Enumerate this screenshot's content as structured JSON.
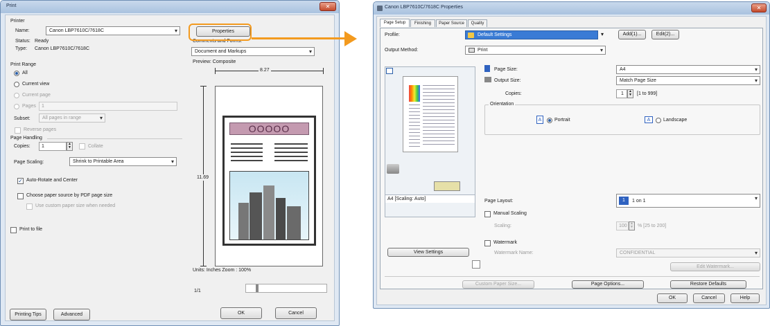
{
  "print_dialog": {
    "title": "Print",
    "printer_section": "Printer",
    "name_label": "Name:",
    "name_value": "Canon LBP7610C/7618C",
    "properties_button": "Properties",
    "status_label": "Status:",
    "status_value": "Ready",
    "type_label": "Type:",
    "type_value": "Canon LBP7610C/7618C",
    "comments_label": "Comments and Forms:",
    "comments_value": "Document and Markups",
    "print_range_label": "Print Range",
    "range_all": "All",
    "range_current_view": "Current view",
    "range_current_page": "Current page",
    "range_pages": "Pages",
    "pages_value": "1",
    "subset_label": "Subset:",
    "subset_value": "All pages in range",
    "reverse_pages": "Reverse pages",
    "page_handling_label": "Page Handling",
    "copies_label": "Copies:",
    "copies_value": "1",
    "collate_label": "Collate",
    "page_scaling_label": "Page Scaling:",
    "page_scaling_value": "Shrink to Printable Area",
    "auto_rotate": "Auto-Rotate and Center",
    "choose_paper_source": "Choose paper source by PDF page size",
    "use_custom_paper": "Use custom paper size when needed",
    "print_to_file": "Print to file",
    "printing_tips_button": "Printing Tips",
    "advanced_button": "Advanced",
    "preview_label": "Preview: Composite",
    "width_dim": "8.27",
    "height_dim": "11.69",
    "preview_logo_text": "OOOOO",
    "units_zoom": "Units: Inches Zoom : 100%",
    "page_counter": "1/1",
    "ok_button": "OK",
    "cancel_button": "Cancel"
  },
  "properties_dialog": {
    "title": "Canon LBP7610C/7618C Properties",
    "tabs": [
      "Page Setup",
      "Finishing",
      "Paper Source",
      "Quality"
    ],
    "profile_label": "Profile:",
    "profile_value": "Default Settings",
    "add_button": "Add(1)...",
    "edit_button": "Edit(2)...",
    "output_method_label": "Output Method:",
    "output_method_value": "Print",
    "page_size_label": "Page Size:",
    "page_size_value": "A4",
    "output_size_label": "Output Size:",
    "output_size_value": "Match Page Size",
    "copies_label": "Copies:",
    "copies_value": "1",
    "copies_range": "[1 to 999]",
    "orientation_label": "Orientation",
    "portrait_label": "Portrait",
    "landscape_label": "Landscape",
    "page_layout_label": "Page Layout:",
    "page_layout_value": "1 on 1",
    "manual_scaling_label": "Manual Scaling",
    "scaling_label": "Scaling:",
    "scaling_value": "100",
    "scaling_range": "% [25 to 200]",
    "watermark_label": "Watermark",
    "watermark_name_label": "Watermark Name:",
    "watermark_name_value": "CONFIDENTIAL",
    "edit_watermark_button": "Edit Watermark...",
    "preview_caption": "A4 [Scaling: Auto]",
    "view_settings_button": "View Settings",
    "custom_paper_size_button": "Custom Paper Size...",
    "page_options_button": "Page Options...",
    "restore_defaults_button": "Restore Defaults",
    "ok_button": "OK",
    "cancel_button": "Cancel",
    "help_button": "Help"
  },
  "colors": {
    "callout": "#f39a1e",
    "title_gradient": "#b8cde6",
    "profile_highlight": "#3a7bd5"
  }
}
